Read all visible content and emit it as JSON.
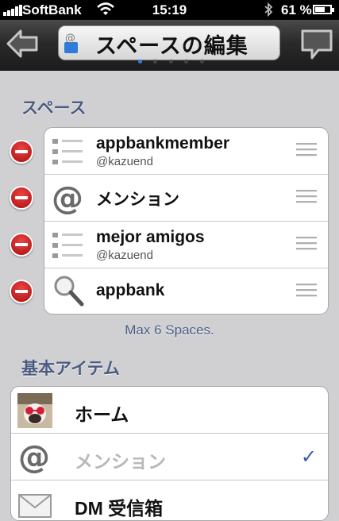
{
  "status": {
    "carrier": "SoftBank",
    "time": "15:19",
    "battery": "61 %"
  },
  "nav": {
    "title": "スペースの編集",
    "page_count": 5,
    "active_page": 0
  },
  "spaces": {
    "header": "スペース",
    "items": [
      {
        "name": "appbankmember",
        "sub": "@kazuend",
        "icon": "list-icon"
      },
      {
        "name": "メンション",
        "sub": "",
        "icon": "at-icon"
      },
      {
        "name": "mejor amigos",
        "sub": "@kazuend",
        "icon": "list-icon"
      },
      {
        "name": "appbank",
        "sub": "",
        "icon": "search-icon"
      }
    ],
    "note": "Max 6 Spaces."
  },
  "basic": {
    "header": "基本アイテム",
    "items": [
      {
        "name": "ホーム",
        "icon": "avatar",
        "checked": false,
        "dim": false
      },
      {
        "name": "メンション",
        "icon": "at-icon",
        "checked": true,
        "dim": true
      },
      {
        "name": "DM 受信箱",
        "icon": "envelope-icon",
        "checked": false,
        "dim": false
      }
    ]
  },
  "colors": {
    "section_text": "#4b5b80",
    "delete_red": "#cc1b1b",
    "check_blue": "#3a5a9a",
    "page_dot_active": "#2d7de0"
  }
}
